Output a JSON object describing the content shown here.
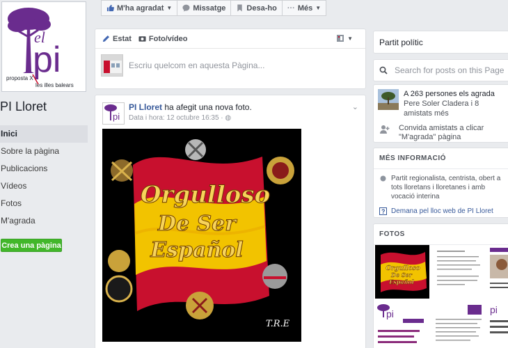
{
  "page": {
    "name": "PI Lloret",
    "logo": {
      "word_el": "el",
      "word_pi": "pi",
      "tagline_left": "proposta X",
      "tagline_right": "les illes balears"
    }
  },
  "nav": {
    "items": [
      "Inici",
      "Sobre la pàgina",
      "Publicacions",
      "Vídeos",
      "Fotos",
      "M'agrada"
    ],
    "create_page": "Crea una pàgina"
  },
  "actions": {
    "liked": "M'ha agradat",
    "message": "Missatge",
    "save": "Desa-ho",
    "more": "Més"
  },
  "composer": {
    "tab_status": "Estat",
    "tab_photo": "Foto/vídeo",
    "placeholder": "Escriu quelcom en aquesta Pàgina..."
  },
  "post": {
    "author": "PI Lloret",
    "action": " ha afegit una nova foto.",
    "time": "Data i hora: 12 octubre 16:35 ·",
    "image": {
      "line1": "Orgulloso",
      "line2": "De Ser",
      "line3": "Español",
      "signature": "T.R.E"
    }
  },
  "sidebar": {
    "category": "Partit polític",
    "search_placeholder": "Search for posts on this Page",
    "likes_text": "A 263 persones els agrada",
    "likes_sub": "Pere Soler Cladera i 8 amistats més",
    "invite_text": "Convida amistats a clicar \"M'agrada\" pàgina",
    "info_title": "MÉS INFORMACIÓ",
    "info_desc": "Partit regionalista, centrista, obert a tots lloretans i lloretanes i amb vocació interina",
    "info_link": "Demana pel lloc web de PI Lloret",
    "photos_title": "FOTOS"
  },
  "colors": {
    "brand_purple": "#6a2c8e",
    "link_blue": "#365899",
    "create_green": "#42b72a",
    "flag_red": "#c8102e",
    "flag_yellow": "#f2c300"
  }
}
